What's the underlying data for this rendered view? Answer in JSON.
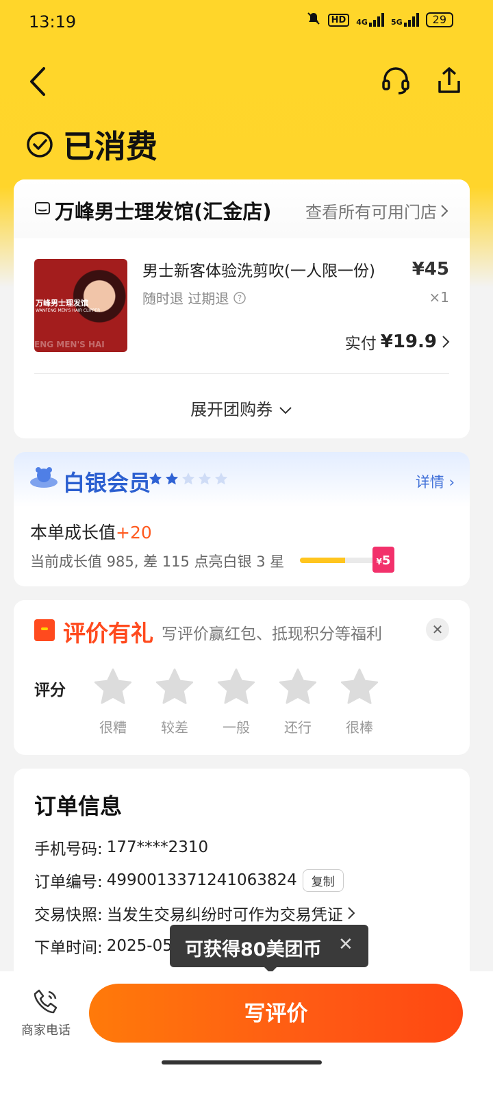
{
  "status_bar": {
    "time": "13:19",
    "network1": "4G",
    "network2": "5G",
    "hd_label": "HD",
    "battery": "29"
  },
  "header": {
    "status": "已消费"
  },
  "shop": {
    "name": "万峰男士理发馆(汇金店)",
    "link": "查看所有可用门店",
    "thumb_line1": "万峰男士理发馆",
    "thumb_line2": "WANFENG MEN'S HAIR CLIPPER",
    "thumb_line3": "ENG MEN'S HAI",
    "deal_title": "男士新客体验洗剪吹(一人限一份)",
    "deal_sub": "随时退 过期退",
    "price": "¥45",
    "qty": "×1",
    "paid_label": "实付",
    "paid_value": "¥19.9",
    "expand": "展开团购券"
  },
  "member": {
    "title": "白银会员",
    "stars_filled": 2,
    "stars_total": 5,
    "detail": "详情",
    "grow_label": "本单成长值",
    "grow_plus": "+20",
    "grow_sub": "当前成长值 985, 差 115 点亮白银 3 星",
    "progress": 0.6,
    "redpack": "5"
  },
  "review": {
    "title": "评价有礼",
    "subtitle": "写评价赢红包、抵现积分等福利",
    "close": "✕",
    "label": "评分",
    "stars": [
      "很糟",
      "较差",
      "一般",
      "还行",
      "很棒"
    ]
  },
  "order": {
    "title": "订单信息",
    "phone_label": "手机号码:",
    "phone": "177****2310",
    "id_label": "订单编号:",
    "id": "4990013371241063824",
    "copy": "复制",
    "snapshot_label": "交易快照:",
    "snapshot": "当发生交易纠纷时可作为交易凭证",
    "time_label": "下单时间:",
    "time": "2025-05"
  },
  "tooltip": {
    "text": "可获得80美团币",
    "close": "✕"
  },
  "bottom": {
    "call_label": "商家电话",
    "write_review": "写评价"
  },
  "colors": {
    "accent_yellow": "#ffd62a",
    "orange": "#ff5a14",
    "member_blue": "#2b5fd0"
  }
}
